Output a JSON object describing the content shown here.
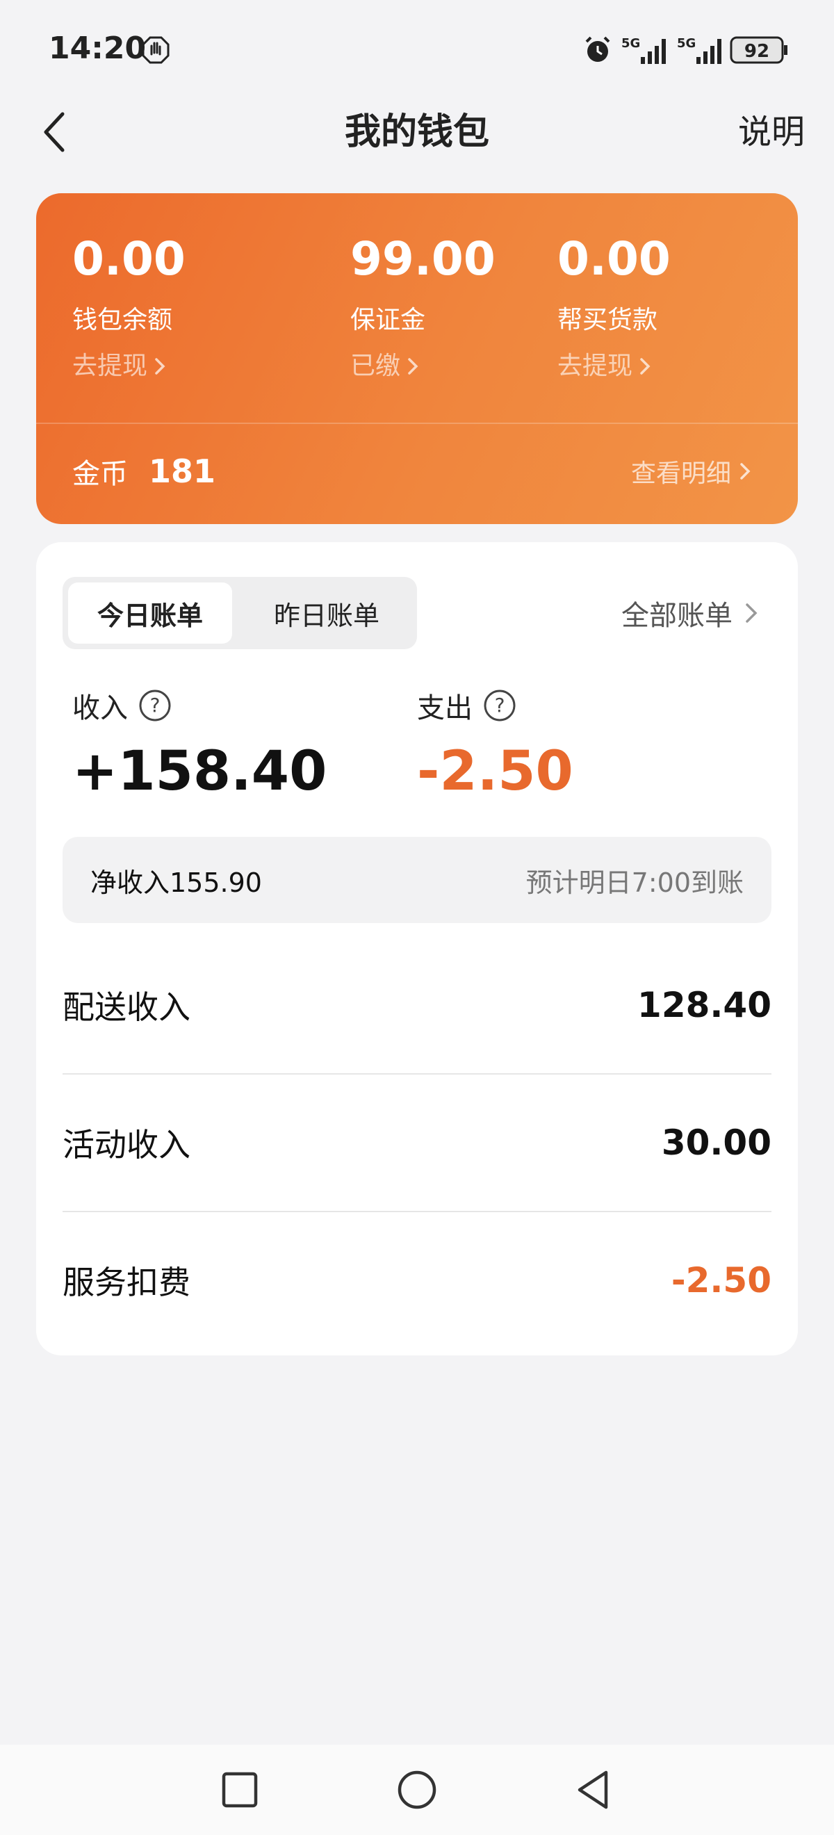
{
  "status_bar": {
    "time": "14:20",
    "battery": "92",
    "network_1": "5G",
    "network_2": "5G",
    "icons": [
      "hand-icon",
      "alarm-icon",
      "signal-icon",
      "signal-icon",
      "battery-icon"
    ]
  },
  "nav": {
    "title": "我的钱包",
    "help_label": "说明"
  },
  "wallet": {
    "balance": {
      "amount": "0.00",
      "label": "钱包余额",
      "link": "去提现"
    },
    "deposit": {
      "amount": "99.00",
      "label": "保证金",
      "link": "已缴"
    },
    "purchase": {
      "amount": "0.00",
      "label": "帮买货款",
      "link": "去提现"
    },
    "coins_label": "金币",
    "coins_value": "181",
    "detail_link": "查看明细"
  },
  "bills": {
    "tabs": [
      "今日账单",
      "昨日账单"
    ],
    "active_tab": 0,
    "all_bills_label": "全部账单",
    "income_label": "收入",
    "income_value": "+158.40",
    "expense_label": "支出",
    "expense_value": "-2.50",
    "net_income": "净收入155.90",
    "arrival_note": "预计明日7:00到账",
    "items": [
      {
        "label": "配送收入",
        "value": "128.40"
      },
      {
        "label": "活动收入",
        "value": "30.00"
      },
      {
        "label": "服务扣费",
        "value": "-2.50"
      }
    ]
  },
  "colors": {
    "accent": "#ec6a2c",
    "negative": "#e8692d"
  }
}
